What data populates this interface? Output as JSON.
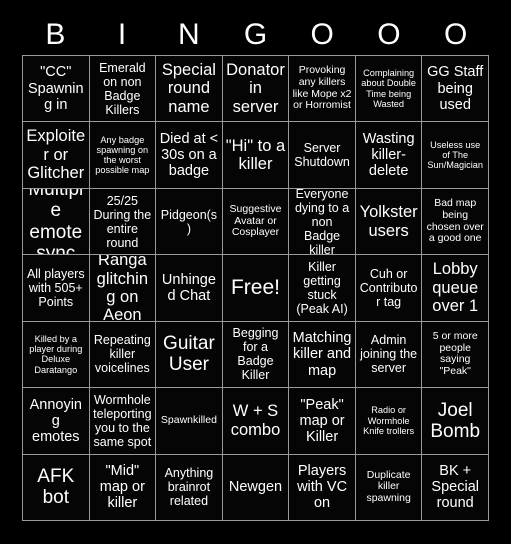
{
  "card": {
    "title": "BINGOOO",
    "header_letters": [
      "B",
      "I",
      "N",
      "G",
      "O",
      "O",
      "O"
    ],
    "columns": 7,
    "rows": 7,
    "background_color": "#000000",
    "text_color": "#ffffff",
    "grid_line_color": "#9a9a9a",
    "free_space": "Free!",
    "cells": [
      [
        {
          "text": "\"CC\" Spawning in",
          "size": "md"
        },
        {
          "text": "Emerald on non Badge Killers",
          "size": "sm"
        },
        {
          "text": "Special round name",
          "size": "lg"
        },
        {
          "text": "Donator in server",
          "size": "lg"
        },
        {
          "text": "Provoking any killers like Mope x2 or Horromist",
          "size": "xs"
        },
        {
          "text": "Complaining about Double Time being Wasted",
          "size": "xxs"
        },
        {
          "text": "GG Staff being used",
          "size": "md"
        }
      ],
      [
        {
          "text": "Exploiter or Glitcher",
          "size": "lg"
        },
        {
          "text": "Any badge spawning on the worst possible map",
          "size": "xxs"
        },
        {
          "text": "Died at < 30s on a badge",
          "size": "md"
        },
        {
          "text": "\"Hi\" to a killer",
          "size": "lg"
        },
        {
          "text": "Server Shutdown",
          "size": "sm"
        },
        {
          "text": "Wasting killer-delete",
          "size": "md"
        },
        {
          "text": "Useless use of The Sun/Magician",
          "size": "xxs"
        }
      ],
      [
        {
          "text": "Multiple emote sync",
          "size": "xl"
        },
        {
          "text": "25/25 During the entire round",
          "size": "sm"
        },
        {
          "text": "Pidgeon(s)",
          "size": "sm"
        },
        {
          "text": "Suggestive Avatar or Cosplayer",
          "size": "xs"
        },
        {
          "text": "Everyone dying to a non Badge killer",
          "size": "sm"
        },
        {
          "text": "Yolkster users",
          "size": "lg"
        },
        {
          "text": "Bad map being chosen over a good one",
          "size": "xs"
        }
      ],
      [
        {
          "text": "All players with 505+ Points",
          "size": "sm"
        },
        {
          "text": "Ranga glitching on Aeon",
          "size": "lg"
        },
        {
          "text": "Unhinged Chat",
          "size": "md"
        },
        {
          "text": "Free!",
          "size": "free"
        },
        {
          "text": "Killer getting stuck (Peak AI)",
          "size": "sm"
        },
        {
          "text": "Cuh or Contributor tag",
          "size": "sm"
        },
        {
          "text": "Lobby queue over 1",
          "size": "lg"
        }
      ],
      [
        {
          "text": "Killed by a player during Deluxe Daratango",
          "size": "xxs"
        },
        {
          "text": "Repeating killer voicelines",
          "size": "sm"
        },
        {
          "text": "Guitar User",
          "size": "xl"
        },
        {
          "text": "Begging for a Badge Killer",
          "size": "sm"
        },
        {
          "text": "Matching killer and map",
          "size": "md"
        },
        {
          "text": "Admin joining the server",
          "size": "sm"
        },
        {
          "text": "5 or more people saying \"Peak\"",
          "size": "xs"
        }
      ],
      [
        {
          "text": "Annoying emotes",
          "size": "md"
        },
        {
          "text": "Wormhole teleporting you to the same spot",
          "size": "sm"
        },
        {
          "text": "Spawnkilled",
          "size": "xs"
        },
        {
          "text": "W + S combo",
          "size": "lg"
        },
        {
          "text": "\"Peak\" map or Killer",
          "size": "md"
        },
        {
          "text": "Radio or Wormhole Knife trollers",
          "size": "xxs"
        },
        {
          "text": "Joel Bomb",
          "size": "xl"
        }
      ],
      [
        {
          "text": "AFK bot",
          "size": "xl"
        },
        {
          "text": "\"Mid\" map or killer",
          "size": "md"
        },
        {
          "text": "Anything brainrot related",
          "size": "sm"
        },
        {
          "text": "Newgen",
          "size": "md"
        },
        {
          "text": "Players with VC on",
          "size": "md"
        },
        {
          "text": "Duplicate killer spawning",
          "size": "xs"
        },
        {
          "text": "BK + Special round",
          "size": "md"
        }
      ]
    ]
  }
}
